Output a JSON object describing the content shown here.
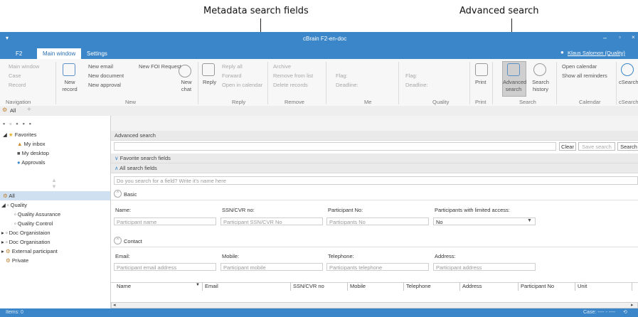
{
  "annotations": {
    "metadata": "Metadata search fields",
    "advanced": "Advanced search"
  },
  "window": {
    "title": "cBrain F2-en-doc",
    "user": "Klaus Salomon (Quality)"
  },
  "top_tabs": [
    "F2",
    "Main window",
    "Settings"
  ],
  "ribbon": {
    "navigation": {
      "items": [
        "Main window",
        "Case",
        "Record"
      ],
      "label": "Navigation"
    },
    "new_record": "New record",
    "new_group": {
      "items": [
        "New email",
        "New document",
        "New approval",
        "New FOI Request"
      ],
      "chat": "New chat",
      "label": "New"
    },
    "reply_group": {
      "reply": "Reply",
      "items": [
        "Reply all",
        "Forward",
        "Open in calendar"
      ],
      "label": "Reply"
    },
    "remove_group": {
      "items": [
        "Archive",
        "Remove from list",
        "Delete records"
      ],
      "label": "Remove"
    },
    "me_group": {
      "flag": "Flag:",
      "deadline": "Deadline:",
      "label": "Me"
    },
    "quality_group": {
      "flag": "Flag:",
      "deadline": "Deadline:",
      "label": "Quality"
    },
    "print_group": {
      "print": "Print",
      "label": "Print"
    },
    "search_group": {
      "advanced": "Advanced search",
      "history": "Search history",
      "label": "Search"
    },
    "calendar_group": {
      "open": "Open calendar",
      "reminders": "Show all reminders",
      "label": "Calendar"
    },
    "csearch_group": {
      "csearch": "cSearch",
      "label": "cSearch"
    }
  },
  "doc_tab": "All",
  "favorites": {
    "header": "Favorites",
    "items": [
      "My inbox",
      "My desktop",
      "Approvals"
    ]
  },
  "tree": {
    "all": "All",
    "items": [
      "Quality",
      "Quality Assurance",
      "Quality Control",
      "Doc Organistaion",
      "Doc Organisation",
      "External participant",
      "Private"
    ]
  },
  "search": {
    "title": "Advanced search",
    "clear": "Clear",
    "save": "Save search",
    "search": "Search",
    "favorite_fields": "Favorite search fields",
    "all_fields": "All search fields",
    "field_finder_placeholder": "Do you search for a field? Write it's name here",
    "basic": {
      "label": "Basic",
      "name_label": "Name:",
      "name_ph": "Participant name",
      "ssn_label": "SSN/CVR no:",
      "ssn_ph": "Participant SSN/CVR No",
      "pno_label": "Participant No:",
      "pno_ph": "Participants No",
      "limited_label": "Participants with limited access:",
      "limited_value": "No"
    },
    "contact": {
      "label": "Contact",
      "email_label": "Email:",
      "email_ph": "Participant email address",
      "mobile_label": "Mobile:",
      "mobile_ph": "Participant mobile",
      "phone_label": "Telephone:",
      "phone_ph": "Participants telephone",
      "address_label": "Address:",
      "address_ph": "Participant address"
    },
    "columns": [
      "Name",
      "Email",
      "SSN/CVR no",
      "Mobile",
      "Telephone",
      "Address",
      "Participant No",
      "Unit"
    ]
  },
  "status": {
    "items": "Items: 0",
    "case": "Case: ---- - ----"
  },
  "colors": {
    "accent": "#3b86c8"
  }
}
